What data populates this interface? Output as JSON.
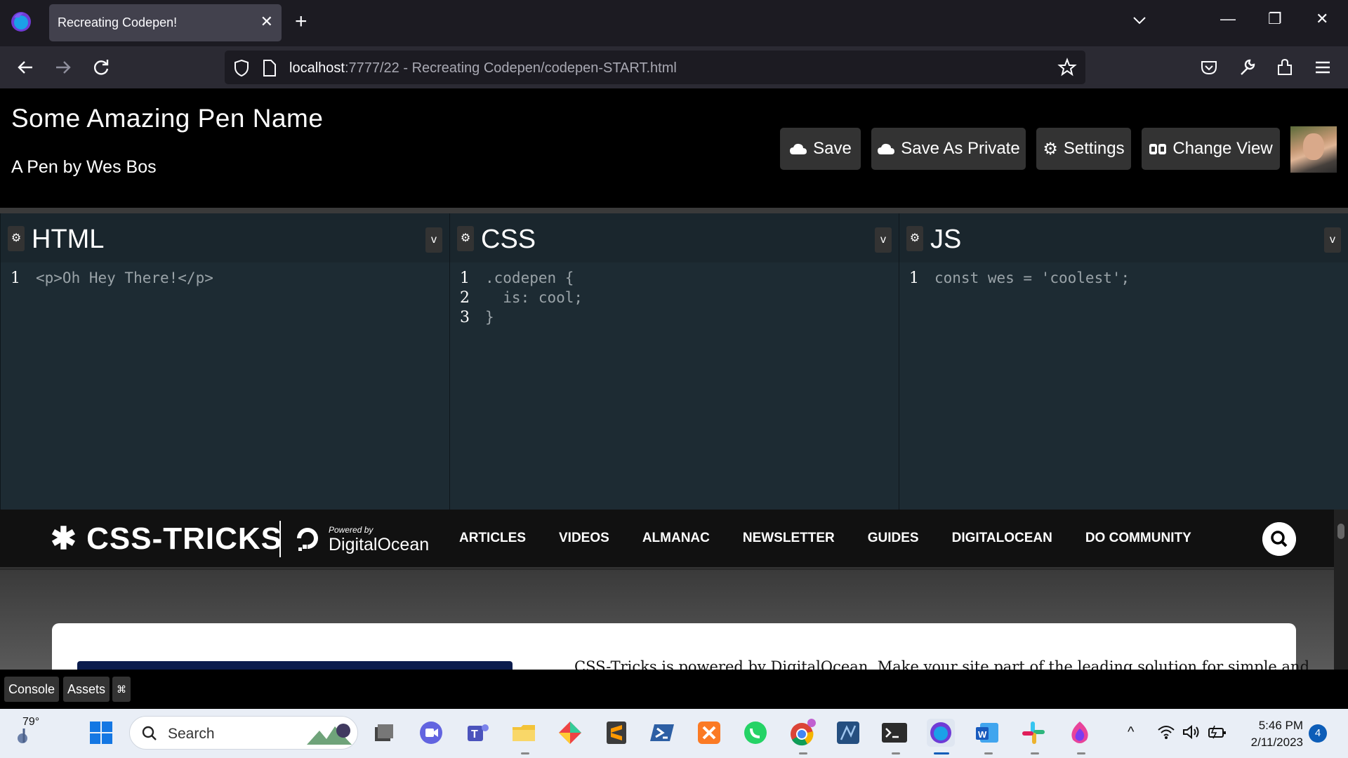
{
  "browser": {
    "tab_title": "Recreating Codepen!",
    "tab_close": "✕",
    "new_tab": "+",
    "url_host": "localhost",
    "url_rest": ":7777/22 - Recreating Codepen/codepen-START.html",
    "win_min": "—",
    "win_restore": "❐",
    "win_close": "✕"
  },
  "pen": {
    "title": "Some Amazing Pen Name",
    "author": "A Pen by Wes Bos",
    "buttons": {
      "save": "Save",
      "save_private": "Save As Private",
      "settings": "Settings",
      "change_view": "Change View"
    }
  },
  "editors": [
    {
      "title": "HTML",
      "lines": [
        {
          "n": "1",
          "code": "<p>Oh Hey There!</p>"
        }
      ]
    },
    {
      "title": "CSS",
      "lines": [
        {
          "n": "1",
          "code": ".codepen {"
        },
        {
          "n": "2",
          "code": "  is: cool;"
        },
        {
          "n": "3",
          "code": "}"
        }
      ]
    },
    {
      "title": "JS",
      "lines": [
        {
          "n": "1",
          "code": "const wes = 'coolest';"
        }
      ]
    }
  ],
  "editor_gear": "⚙",
  "editor_dropdown": "v",
  "preview": {
    "logo": "✱ CSS-TRICKS",
    "powered_by": "Powered by",
    "do_name": "DigitalOcean",
    "links": [
      "ARTICLES",
      "VIDEOS",
      "ALMANAC",
      "NEWSLETTER",
      "GUIDES",
      "DIGITALOCEAN",
      "DO COMMUNITY"
    ],
    "card_text": "CSS-Tricks is powered by DigitalOcean. Make your site part of the leading solution for simple and"
  },
  "bottom": {
    "console": "Console",
    "assets": "Assets",
    "shortcut": "⌘"
  },
  "taskbar": {
    "temp": "79°",
    "search": "Search",
    "time": "5:46 PM",
    "date": "2/11/2023",
    "notifications": "4",
    "chevron": "^"
  },
  "colors": {
    "editor_bg": "#1d2b33",
    "button_bg": "#333333",
    "tab_active": "#42414d"
  }
}
